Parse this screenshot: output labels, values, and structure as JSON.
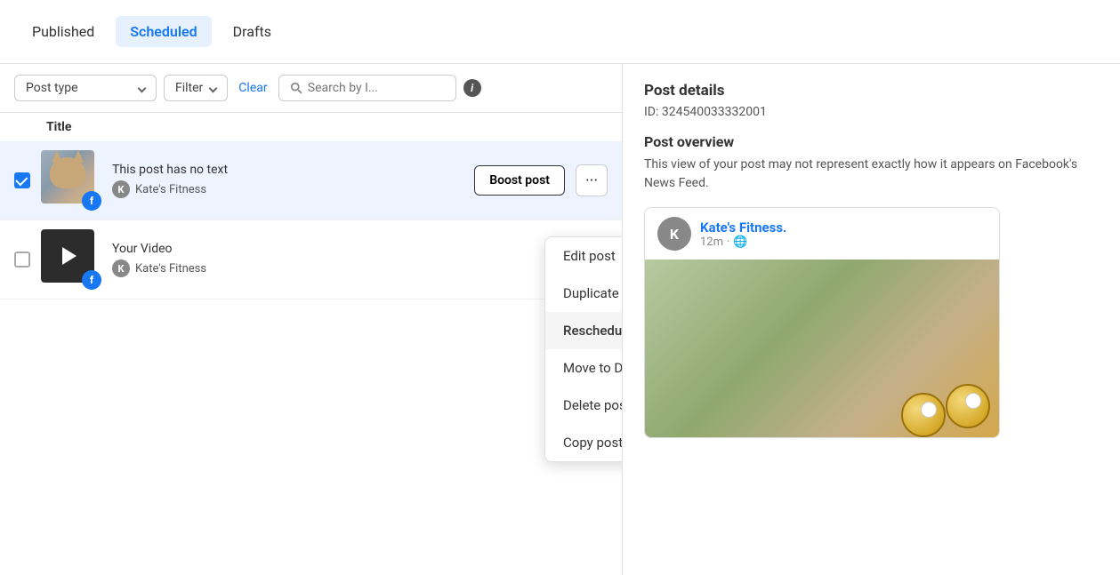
{
  "tabs": [
    {
      "id": "published",
      "label": "Published",
      "active": false
    },
    {
      "id": "scheduled",
      "label": "Scheduled",
      "active": true
    },
    {
      "id": "drafts",
      "label": "Drafts",
      "active": false
    }
  ],
  "filters": {
    "post_type_label": "Post type",
    "filter_label": "Filter",
    "clear_label": "Clear",
    "search_placeholder": "Search by I...",
    "info_icon": "i"
  },
  "table": {
    "title_column": "Title",
    "posts": [
      {
        "id": "post-1",
        "title": "This post has no text",
        "page_name": "Kate's Fitness",
        "page_initial": "K",
        "checked": true,
        "has_boost": true,
        "boost_label": "Boost post",
        "thumb_type": "cat"
      },
      {
        "id": "post-2",
        "title": "Your Video",
        "page_name": "Kate's Fitness",
        "page_initial": "K",
        "checked": false,
        "has_boost": false,
        "thumb_type": "video"
      }
    ]
  },
  "context_menu": {
    "items": [
      {
        "id": "edit-post",
        "label": "Edit post"
      },
      {
        "id": "duplicate-post",
        "label": "Duplicate post"
      },
      {
        "id": "reschedule-post",
        "label": "Reschedule post",
        "highlighted": true
      },
      {
        "id": "move-to-drafts",
        "label": "Move to Drafts"
      },
      {
        "id": "delete-post",
        "label": "Delete post"
      },
      {
        "id": "copy-post-id",
        "label": "Copy post ID"
      }
    ]
  },
  "right_panel": {
    "post_details_title": "Post details",
    "post_id_label": "ID: 324540033332001",
    "post_overview_title": "Post overview",
    "post_overview_desc": "This view of your post may not represent exactly how it appears on Facebook's News Feed.",
    "preview": {
      "page_name": "Kate's Fitness.",
      "time": "12m",
      "audience": "🌐"
    }
  }
}
